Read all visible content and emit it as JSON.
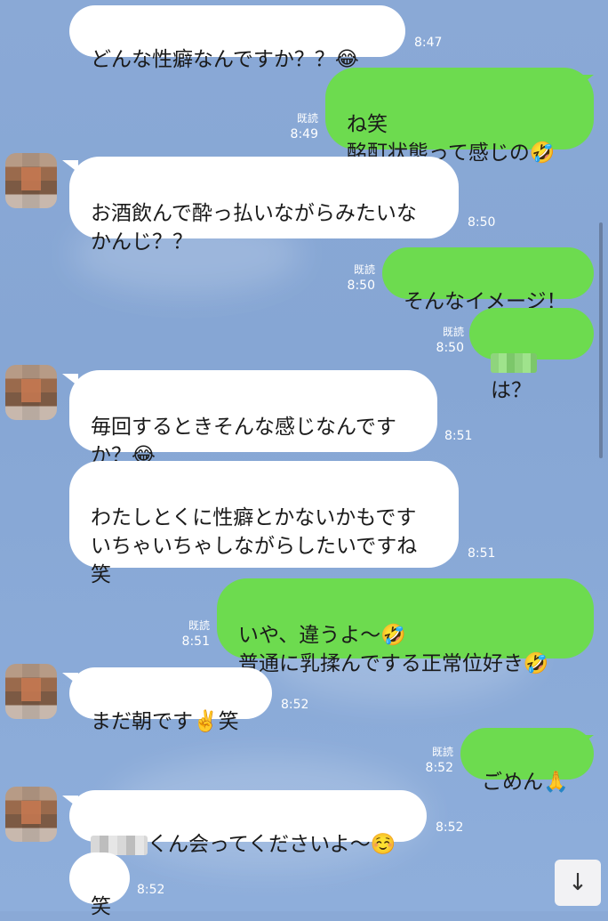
{
  "chat": {
    "messages": [
      {
        "text": "どんな性癖なんですか？？😂",
        "time": "8:47"
      },
      {
        "text": "ね笑\n酩酊状態って感じの🤣",
        "read": "既読",
        "time": "8:49"
      },
      {
        "text": "お酒飲んで酔っ払いながらみたいな\nかんじ？？",
        "time": "8:50"
      },
      {
        "text": "そんなイメージ！",
        "read": "既読",
        "time": "8:50"
      },
      {
        "text": "は？",
        "read": "既読",
        "time": "8:50"
      },
      {
        "text": "毎回するときそんな感じなんです\nか？😂",
        "time": "8:51"
      },
      {
        "text": "わたしとくに性癖とかないかもです\nいちゃいちゃしながらしたいですね\n笑",
        "time": "8:51"
      },
      {
        "text": "いや、違うよ〜🤣\n普通に乳揉んでする正常位好き🤣",
        "read": "既読",
        "time": "8:51"
      },
      {
        "text": "まだ朝です✌️笑",
        "time": "8:52"
      },
      {
        "text": "ごめん🙏",
        "read": "既読",
        "time": "8:52"
      },
      {
        "text": "くん会ってくださいよ〜☺️",
        "time": "8:52"
      },
      {
        "text": "笑",
        "time": "8:52"
      }
    ]
  },
  "icons": {
    "scroll_down": "arrow-down-icon"
  },
  "colors": {
    "background": "#8aa9d6",
    "bubble_in": "#ffffff",
    "bubble_out": "#6ddb4f"
  }
}
